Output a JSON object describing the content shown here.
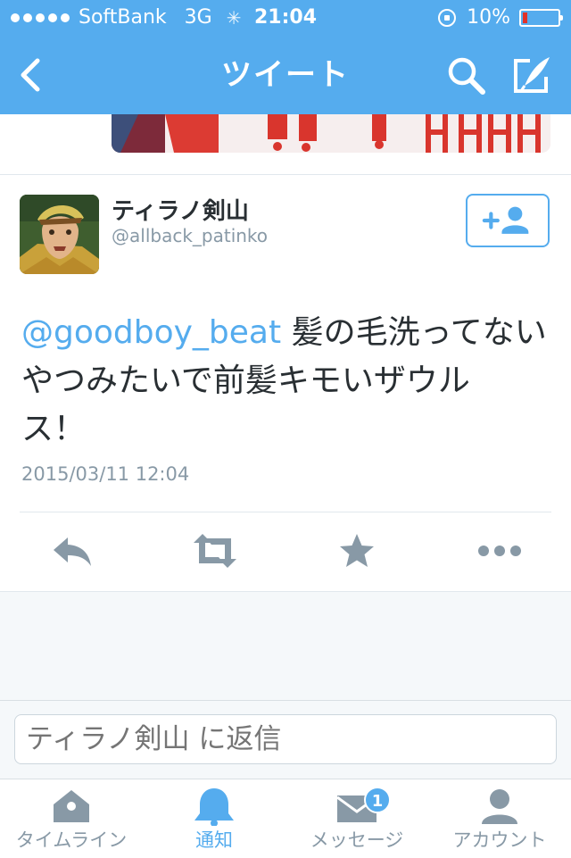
{
  "status_bar": {
    "carrier": "SoftBank",
    "network": "3G",
    "time": "21:04",
    "battery_percent": "10%",
    "battery_level": 0.1
  },
  "nav": {
    "title": "ツイート",
    "back_icon": "back-chevron-icon",
    "search_icon": "search-icon",
    "compose_icon": "compose-tweet-icon"
  },
  "tweet": {
    "display_name": "ティラノ剣山",
    "screen_name": "@allback_patinko",
    "mention": "@goodboy_beat",
    "text_line1_rest": " 髪の毛洗ってない",
    "text_line2": "やつみたいで前髪キモいザウル",
    "text_line3": "ス！",
    "timestamp": "2015/03/11 12:04"
  },
  "actions": [
    "reply-icon",
    "retweet-icon",
    "favorite-star-icon",
    "more-dots-icon"
  ],
  "reply": {
    "placeholder": "ティラノ剣山 に返信"
  },
  "tabs": [
    {
      "label": "タイムライン",
      "icon": "home-icon"
    },
    {
      "label": "通知",
      "icon": "bell-icon"
    },
    {
      "label": "メッセージ",
      "icon": "envelope-icon",
      "badge": "1"
    },
    {
      "label": "アカウント",
      "icon": "person-icon"
    }
  ],
  "colors": {
    "brand": "#55acee",
    "text": "#292f33",
    "muted": "#8899a6",
    "action_gray": "#8899a6"
  }
}
